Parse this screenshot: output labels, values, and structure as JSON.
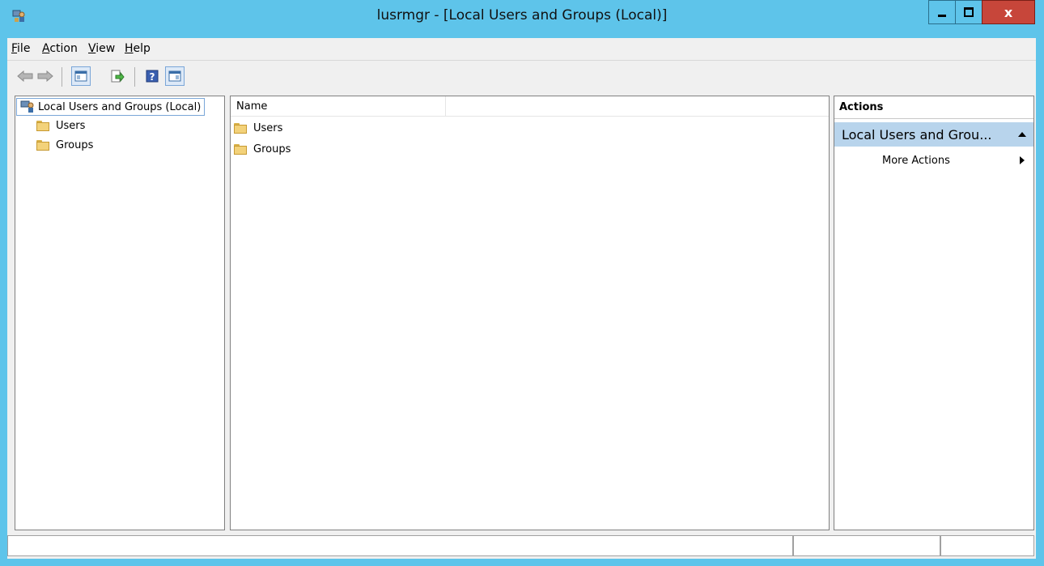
{
  "window": {
    "title": "lusrmgr - [Local Users and Groups (Local)]",
    "close_label": "x"
  },
  "menu": {
    "file": {
      "letter": "F",
      "rest": "ile"
    },
    "action": {
      "letter": "A",
      "rest": "ction"
    },
    "view": {
      "letter": "V",
      "rest": "iew"
    },
    "help": {
      "letter": "H",
      "rest": "elp"
    }
  },
  "toolbar": {
    "icons": [
      "back-icon",
      "forward-icon",
      "show-hide-console-tree-icon",
      "export-list-icon",
      "help-icon",
      "show-hide-action-pane-icon"
    ]
  },
  "tree": {
    "root_label": "Local Users and Groups (Local)",
    "items": [
      {
        "label": "Users"
      },
      {
        "label": "Groups"
      }
    ]
  },
  "list": {
    "columns": [
      "Name"
    ],
    "rows": [
      {
        "name": "Users"
      },
      {
        "name": "Groups"
      }
    ]
  },
  "actions": {
    "header": "Actions",
    "section_title": "Local Users and Grou...",
    "items": [
      {
        "label": "More Actions"
      }
    ]
  },
  "colors": {
    "title_bar": "#5ec4ea",
    "close_button": "#c7463a",
    "selected_section": "#b8d4ec"
  }
}
